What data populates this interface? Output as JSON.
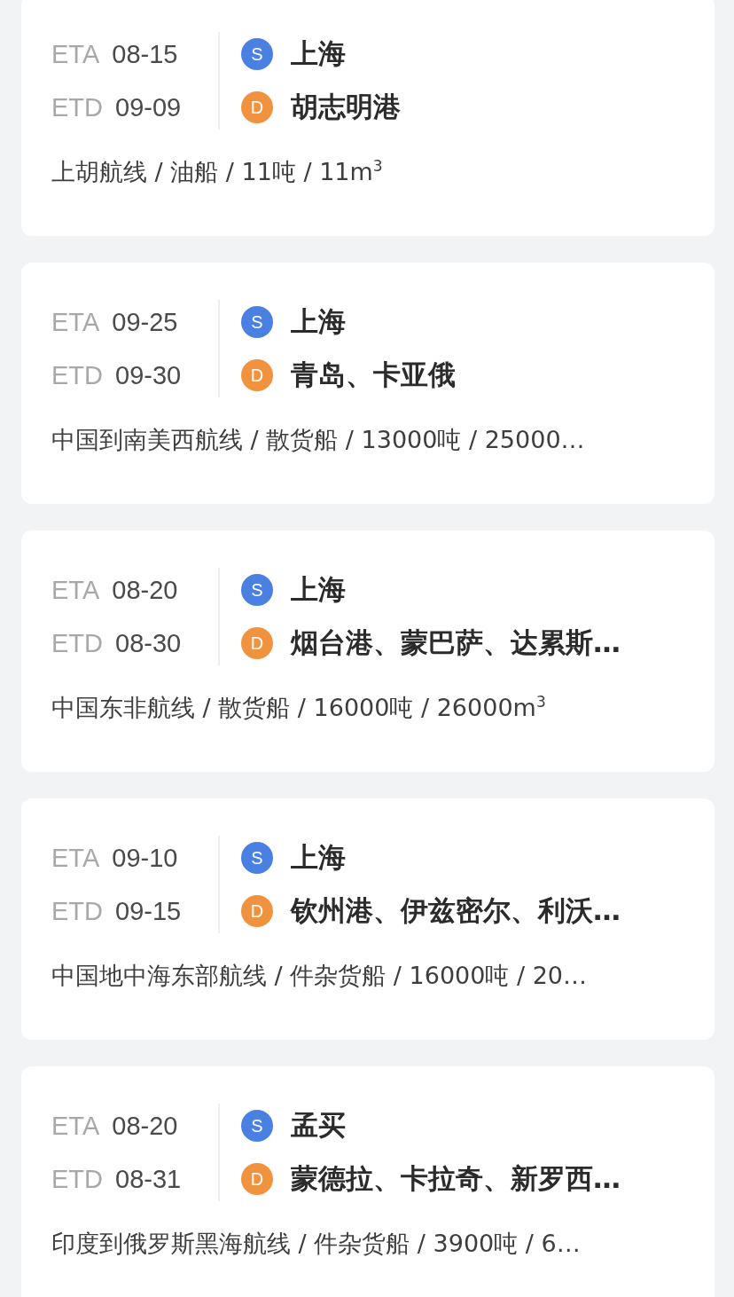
{
  "cards": [
    {
      "eta_label": "ETA",
      "eta": "08-15",
      "etd_label": "ETD",
      "etd": "09-09",
      "source": {
        "badge": "S",
        "port": "上海"
      },
      "destination": {
        "badge": "D",
        "port": "胡志明港"
      },
      "info": "上胡航线 / 油船 / 11吨 / 11m$^{3}$"
    },
    {
      "eta_label": "ETA",
      "eta": "09-25",
      "etd_label": "ETD",
      "etd": "09-30",
      "source": {
        "badge": "S",
        "port": "上海"
      },
      "destination": {
        "badge": "D",
        "port": "青岛、卡亚俄"
      },
      "info": "中国到南美西航线 / 散货船 / 13000吨 / 25000…"
    },
    {
      "eta_label": "ETA",
      "eta": "08-20",
      "etd_label": "ETD",
      "etd": "08-30",
      "source": {
        "badge": "S",
        "port": "上海"
      },
      "destination": {
        "badge": "D",
        "port": "烟台港、蒙巴萨、达累斯…"
      },
      "info": "中国东非航线 / 散货船 / 16000吨 / 26000m$^{3}$"
    },
    {
      "eta_label": "ETA",
      "eta": "09-10",
      "etd_label": "ETD",
      "etd": "09-15",
      "source": {
        "badge": "S",
        "port": "上海"
      },
      "destination": {
        "badge": "D",
        "port": "钦州港、伊兹密尔、利沃…"
      },
      "info": "中国地中海东部航线 / 件杂货船 / 16000吨 / 20…"
    },
    {
      "eta_label": "ETA",
      "eta": "08-20",
      "etd_label": "ETD",
      "etd": "08-31",
      "source": {
        "badge": "S",
        "port": "孟买"
      },
      "destination": {
        "badge": "D",
        "port": "蒙德拉、卡拉奇、新罗西…"
      },
      "info": "印度到俄罗斯黑海航线 / 件杂货船 / 3900吨 / 6…"
    }
  ]
}
